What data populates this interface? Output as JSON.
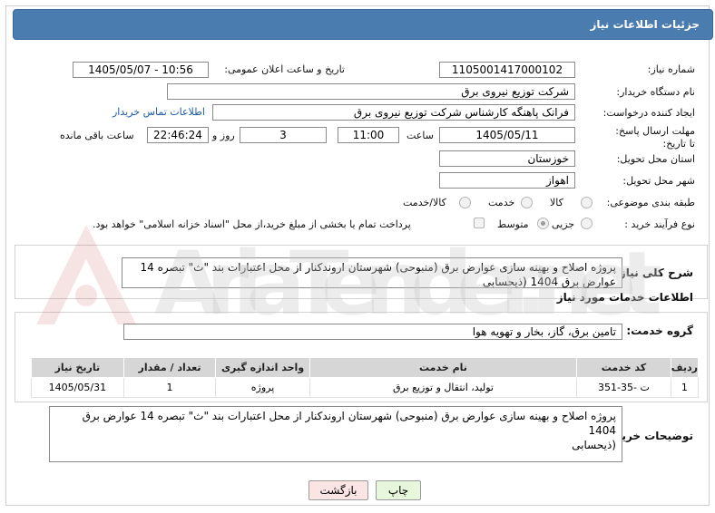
{
  "header": {
    "title": "جزئیات اطلاعات نیاز"
  },
  "form": {
    "need_number_label": "شماره نیاز:",
    "need_number": "1105001417000102",
    "announce_label": "تاریخ و ساعت اعلان عمومی:",
    "announce_value": "1405/05/07 - 10:56",
    "buyer_label": "نام دستگاه خریدار:",
    "buyer_value": "شرکت توزیع نیروی برق",
    "creator_label": "ایجاد کننده درخواست:",
    "creator_value": "فرانک  پاهنگه کارشناس  شرکت توزیع نیروی برق",
    "contact_link": "اطلاعات تماس خریدار",
    "deadline_label": "مهلت ارسال پاسخ: تا تاریخ:",
    "deadline_date": "1405/05/11",
    "time_label": "ساعت",
    "deadline_time": "11:00",
    "days_value": "3",
    "days_label": "روز و",
    "remain_time": "22:46:24",
    "remain_label": "ساعت باقی مانده",
    "province_label": "استان محل تحویل:",
    "province_value": "خوزستان",
    "city_label": "شهر محل تحویل:",
    "city_value": "اهواز",
    "category_label": "طبقه بندی موضوعی:",
    "cat_opt1": "کالا",
    "cat_opt2": "خدمت",
    "cat_opt3": "کالا/خدمت",
    "process_label": "نوع فرآیند خرید :",
    "proc_opt1": "جزیی",
    "proc_opt2": "متوسط",
    "payment_note": "پرداخت تمام یا بخشی از مبلغ خرید،از محل \"اسناد خزانه اسلامی\" خواهد بود."
  },
  "summary": {
    "label": "شرح کلی نیاز:",
    "text": "پروژه اصلاح و بهینه سازی عوارض برق (منبوحی) شهرستان اروندکنار از محل اعتبارات بند \"ث\" تبصره 14 عوارض برق 1404 (ذیحسابی"
  },
  "services": {
    "section_title": "اطلاعات خدمات مورد نیاز",
    "group_label": "گروه خدمت:",
    "group_value": "تامین برق، گاز، بخار و تهویه هوا",
    "columns": [
      "ردیف",
      "کد خدمت",
      "نام خدمت",
      "واحد اندازه گیری",
      "تعداد / مقدار",
      "تاریخ نیاز"
    ],
    "rows": [
      [
        "1",
        "ت -35-351",
        "تولید، انتقال و توزیع برق",
        "پروژه",
        "1",
        "1405/05/31"
      ]
    ]
  },
  "buyer_notes": {
    "label": "توضیحات خریدار:",
    "text": "پروژه اصلاح و بهینه سازی عوارض برق (منبوحی) شهرستان اروندکنار از محل اعتبارات بند \"ث\" تبصره 14 عوارض برق 1404\n(ذیحسابی"
  },
  "buttons": {
    "print": "چاپ",
    "back": "بازگشت"
  },
  "watermark": {
    "text": "AriaTender.net"
  },
  "colors": {
    "title_bg": "#4a7cb0",
    "print_bg": "#e6f7dc",
    "back_bg": "#fbe4e4"
  }
}
